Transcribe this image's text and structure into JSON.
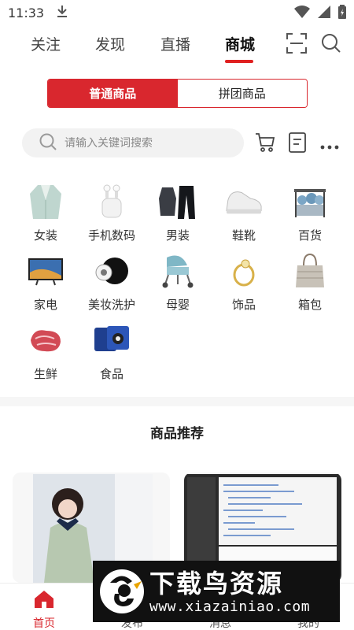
{
  "status_bar": {
    "time": "11:33"
  },
  "top_nav": {
    "tabs": [
      {
        "label": "关注"
      },
      {
        "label": "发现"
      },
      {
        "label": "直播"
      },
      {
        "label": "商城"
      }
    ],
    "active_tab": "商城"
  },
  "segment": {
    "left": "普通商品",
    "right": "拼团商品",
    "active": "普通商品"
  },
  "search": {
    "placeholder": "请输入关键词搜索"
  },
  "categories": [
    {
      "label": "女装",
      "icon": "blazer-icon"
    },
    {
      "label": "手机数码",
      "icon": "earbuds-icon"
    },
    {
      "label": "男装",
      "icon": "suit-icon"
    },
    {
      "label": "鞋靴",
      "icon": "sneaker-icon"
    },
    {
      "label": "百货",
      "icon": "dish-rack-icon"
    },
    {
      "label": "家电",
      "icon": "tv-icon"
    },
    {
      "label": "美妆洗护",
      "icon": "cosmetics-icon"
    },
    {
      "label": "母婴",
      "icon": "stroller-icon"
    },
    {
      "label": "饰品",
      "icon": "ring-icon"
    },
    {
      "label": "箱包",
      "icon": "bag-icon"
    },
    {
      "label": "生鲜",
      "icon": "meat-icon"
    },
    {
      "label": "食品",
      "icon": "snacks-icon"
    }
  ],
  "section": {
    "title": "商品推荐"
  },
  "bottom_nav": [
    {
      "label": "首页",
      "active": true
    },
    {
      "label": "发布"
    },
    {
      "label": "消息"
    },
    {
      "label": "我的"
    }
  ],
  "watermark": {
    "title": "下载鸟资源",
    "url": "www.xiazainiao.com"
  },
  "colors": {
    "accent": "#d9272e",
    "text": "#222222",
    "muted": "#888888"
  }
}
